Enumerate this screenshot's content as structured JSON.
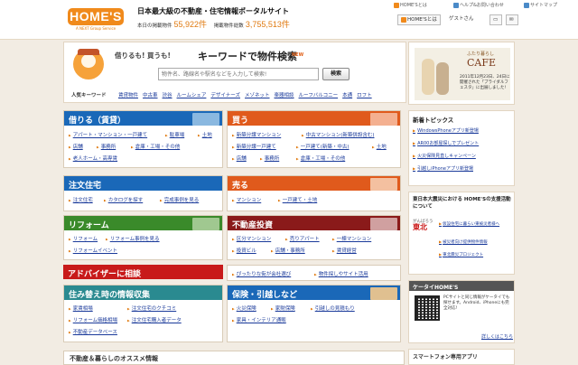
{
  "header": {
    "logo": "HOME'S",
    "logo_sub": "A NEXT Group Service",
    "tagline": "日本最大級の不動産・住宅情報ポータルサイト",
    "stats_label1": "本日の掲載物件",
    "stats_value1": "55,922件",
    "stats_label2": "掲載物件総数",
    "stats_value2": "3,755,513件",
    "links": [
      "HOME'Sとは",
      "ヘルプ&お問い合わせ",
      "サイトマップ"
    ],
    "home_button": "HOME'Sとは",
    "guest_label": "ゲストさん"
  },
  "search": {
    "prefix": "借りるも! 買うも!",
    "title": "キーワードで物件検索",
    "new_badge": "NEW",
    "placeholder": "物件名、路線名や駅名などを入力して検索!",
    "button": "検索",
    "popular_label": "人気キーワード",
    "popular": [
      "賃貸物件",
      "中古車",
      "渋谷",
      "ルームシェア",
      "デザイナーズ",
      "メゾネット",
      "楽器相談",
      "ルーフバルコニー",
      "本通",
      "ロフト"
    ]
  },
  "sections": {
    "rent": {
      "title": "借りる（賃貸）",
      "links": [
        [
          "アパート・マンション・一戸建て",
          "駐車場",
          "土地"
        ],
        [
          "店舗",
          "事務所",
          "倉庫・工場・その他"
        ],
        [
          "老人ホーム・高専賃"
        ]
      ]
    },
    "buy": {
      "title": "買う",
      "links": [
        [
          "新築分譲マンション",
          "中古マンション(新築併設含む)"
        ],
        [
          "新築分譲一戸建て",
          "一戸建て(新築・中古)",
          "土地"
        ],
        [
          "店舗",
          "事務所",
          "倉庫・工場・その他"
        ]
      ]
    },
    "order": {
      "title": "注文住宅",
      "links": [
        "注文住宅",
        "カタログを探す",
        "完成事例を見る"
      ]
    },
    "sell": {
      "title": "売る",
      "links": [
        "マンション",
        "一戸建て・土地"
      ]
    },
    "reform": {
      "title": "リフォーム",
      "links": [
        [
          "リフォーム",
          "リフォーム事例を見る"
        ],
        [
          "リフォームイベント"
        ]
      ]
    },
    "invest": {
      "title": "不動産投資",
      "links": [
        [
          "区分マンション",
          "売りアパート",
          "一棟マンション"
        ],
        [
          "投資ビル",
          "店舗・事務所",
          "賃貸経営"
        ]
      ]
    },
    "advisor": {
      "title": "アドバイザーに相談",
      "links": [
        "ぴったりな街が会社選び",
        "物件探しやサイト活用"
      ]
    },
    "move_info": {
      "title": "住み替え時の情報収集",
      "links": [
        [
          "家賃相場",
          "注文住宅のクチコミ"
        ],
        [
          "リフォーム価格相場",
          "注文住宅購入者データ"
        ],
        [
          "不動産データベース"
        ]
      ]
    },
    "insurance": {
      "title": "保険・引越しなど",
      "links": [
        [
          "火災保険",
          "家財保険",
          "引越しの見積もり"
        ],
        [
          "家具・インテリア通販"
        ]
      ]
    }
  },
  "bottom_title": "不動産＆暮らしのオススメ情報",
  "cafe": {
    "sub": "ふたり暮らし",
    "title": "CAFE",
    "note": "2011年12月23日、24日に開催された「ブライダルフェスタ」に出展しました!"
  },
  "news": {
    "title": "新着トピックス",
    "items": [
      "WindowsPhoneアプリ新登場",
      "AR00お部屋探しでプレゼント",
      "火災保険見直しキャンペーン",
      "引越しiPhoneアプリ新登場"
    ]
  },
  "shinsai": {
    "title": "東日本大震災における HOME'Sの支援活動について",
    "logo_top": "がんばろう",
    "logo_main": "東北",
    "items": [
      "仮設住宅に暮らい東被災者様へ",
      "被災者向け提供物件情報",
      "東北震災プロジェクト"
    ]
  },
  "ktai": {
    "title": "ケータイHOME'S",
    "note": "PCサイトと同じ情報がケータイでも探せます。Android、iPhoneにも完全対応!",
    "more": "詳しくはこちら"
  },
  "smart": {
    "title": "スマートフォン専用アプリ"
  },
  "colors": {
    "accent": "#f08a1c",
    "rent": "#1a68b8",
    "buy": "#e05a1c",
    "order": "#1a68b8",
    "sell": "#e05a1c",
    "reform": "#3a8a2a",
    "invest": "#8a1a1a",
    "advisor": "#c81a1a",
    "move": "#2a8a90",
    "insurance": "#1a68b8"
  }
}
